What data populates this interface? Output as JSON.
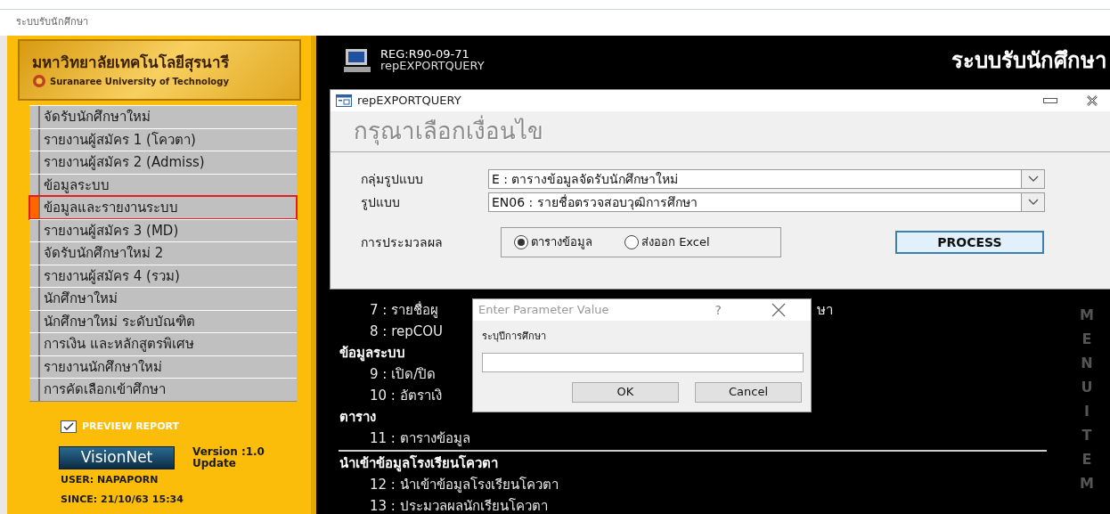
{
  "window": {
    "title": "ระบบรับนักศึกษา"
  },
  "sidebar": {
    "logo": {
      "title": "มหาวิทยาลัยเทคโนโลยีสุรนารี",
      "subtitle": "Suranaree University of Technology"
    },
    "menu": [
      {
        "label": "จัดรับนักศึกษาใหม่",
        "selected": false
      },
      {
        "label": "รายงานผู้สมัคร 1 (โควตา)",
        "selected": false
      },
      {
        "label": "รายงานผู้สมัคร 2 (Admiss)",
        "selected": false
      },
      {
        "label": "ข้อมูลระบบ",
        "selected": false
      },
      {
        "label": "ข้อมูลและรายงานระบบ",
        "selected": true
      },
      {
        "label": "รายงานผู้สมัคร 3 (MD)",
        "selected": false
      },
      {
        "label": "จัดรับนักศึกษาใหม่ 2",
        "selected": false
      },
      {
        "label": "รายงานผู้สมัคร 4 (รวม)",
        "selected": false
      },
      {
        "label": "นักศึกษาใหม่",
        "selected": false
      },
      {
        "label": "นักศึกษาใหม่ ระดับบัณฑิต",
        "selected": false
      },
      {
        "label": "การเงิน และหลักสูตรพิเศษ",
        "selected": false
      },
      {
        "label": "รายงานนักศึกษาใหม่",
        "selected": false
      },
      {
        "label": "การคัดเลือกเข้าศึกษา",
        "selected": false
      }
    ],
    "preview_report": {
      "label": "PREVIEW REPORT",
      "checked": true
    },
    "brand": "VisionNet",
    "version": "Version :1.0",
    "update": "Update",
    "user": "USER: NAPAPORN",
    "since": "SINCE: 21/10/63 15:34"
  },
  "header": {
    "code": "REG:R90-09-71",
    "form": "repEXPORTQUERY",
    "title": "ระบบรับนักศึกษา"
  },
  "menu_list": [
    {
      "kind": "item",
      "text": "7 : รายชื่อผู",
      "tail": "ษา"
    },
    {
      "kind": "item",
      "text": "8 : repCOU"
    },
    {
      "kind": "heading",
      "text": "ข้อมูลระบบ"
    },
    {
      "kind": "item",
      "text": "9 : เปิด/ปิด"
    },
    {
      "kind": "item",
      "text": "10 : อัตราเงิ"
    },
    {
      "kind": "heading",
      "text": "ตาราง"
    },
    {
      "kind": "item",
      "text": "11 : ตารางข้อมูล"
    },
    {
      "kind": "rule"
    },
    {
      "kind": "heading",
      "text": "นำเข้าข้อมูลโรงเรียนโควตา"
    },
    {
      "kind": "item",
      "text": "12 : นำเข้าข้อมูลโรงเรียนโควตา"
    },
    {
      "kind": "item",
      "text": "13 : ประมวลผลนักเรียนโควตา"
    }
  ],
  "side_label": "MENU ITEM",
  "export_dialog": {
    "title": "repEXPORTQUERY",
    "heading": "กรุณาเลือกเงื่อนไข",
    "fields": [
      {
        "label": "กลุ่มรูปแบบ",
        "value": "E : ตารางข้อมูลจัดรับนักศึกษาใหม่"
      },
      {
        "label": "รูปแบบ",
        "value": "EN06 : รายชื่อตรวจสอบวุฒิการศึกษา"
      }
    ],
    "processing_label": "การประมวลผล",
    "options": [
      {
        "label": "ตารางข้อมูล",
        "selected": true
      },
      {
        "label": "ส่งออก Excel",
        "selected": false
      }
    ],
    "process_button": "PROCESS"
  },
  "parameter_dialog": {
    "title": "Enter Parameter Value",
    "help": "?",
    "prompt": "ระบุปีการศึกษา",
    "buttons": [
      "OK",
      "Cancel"
    ]
  }
}
